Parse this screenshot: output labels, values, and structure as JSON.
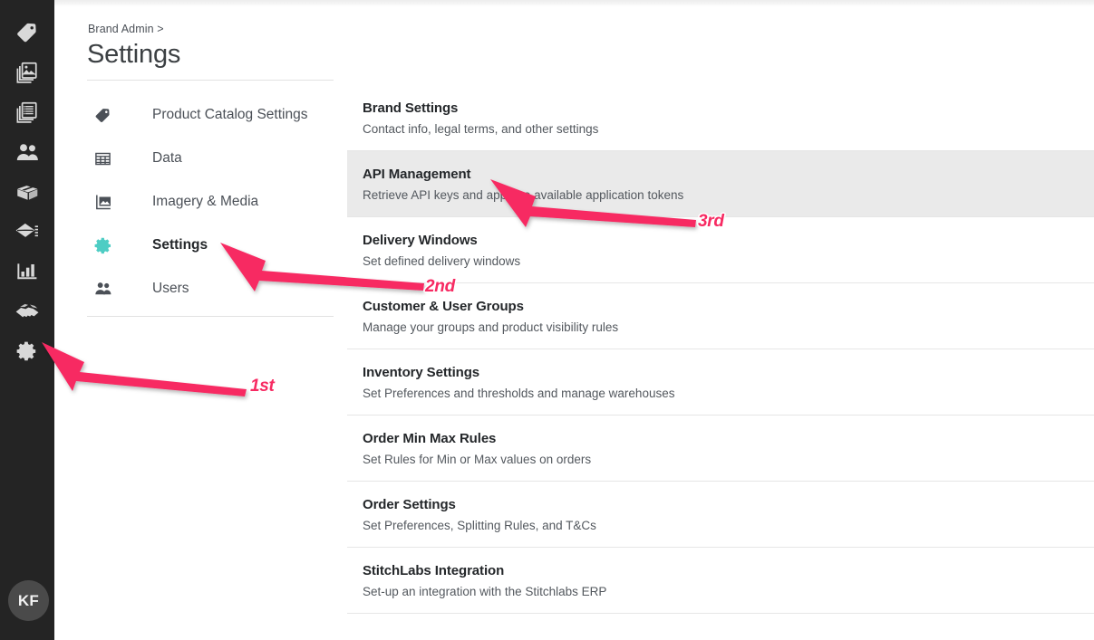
{
  "colors": {
    "rail_bg": "#242424",
    "accent_teal": "#4ecdc4",
    "annotation_pink": "#f72a62",
    "highlight_row": "#eaeaea"
  },
  "rail": {
    "items": [
      {
        "icon": "tag-icon",
        "name": "rail-item-catalog"
      },
      {
        "icon": "images-icon",
        "name": "rail-item-media"
      },
      {
        "icon": "list-document-icon",
        "name": "rail-item-content"
      },
      {
        "icon": "users-icon",
        "name": "rail-item-customers"
      },
      {
        "icon": "box-icon",
        "name": "rail-item-products"
      },
      {
        "icon": "envelope-list-icon",
        "name": "rail-item-orders"
      },
      {
        "icon": "bar-chart-icon",
        "name": "rail-item-reports"
      },
      {
        "icon": "handshake-icon",
        "name": "rail-item-partners"
      },
      {
        "icon": "gear-icon",
        "name": "rail-item-settings"
      }
    ],
    "avatar_initials": "KF"
  },
  "header": {
    "breadcrumb": "Brand Admin >",
    "title": "Settings"
  },
  "subnav": {
    "items": [
      {
        "label": "Product Catalog Settings",
        "icon": "tag-icon",
        "active": false
      },
      {
        "label": "Data",
        "icon": "table-grid-icon",
        "active": false
      },
      {
        "label": "Imagery & Media",
        "icon": "image-icon",
        "active": false
      },
      {
        "label": "Settings",
        "icon": "gear-icon",
        "active": true
      },
      {
        "label": "Users",
        "icon": "users-icon",
        "active": false
      }
    ]
  },
  "settings_list": {
    "rows": [
      {
        "title": "Brand Settings",
        "desc": "Contact info, legal terms, and other settings",
        "highlighted": false
      },
      {
        "title": "API Management",
        "desc": "Retrieve API keys and approve available application tokens",
        "highlighted": true
      },
      {
        "title": "Delivery Windows",
        "desc": "Set defined delivery windows",
        "highlighted": false
      },
      {
        "title": "Customer & User Groups",
        "desc": "Manage your groups and product visibility rules",
        "highlighted": false
      },
      {
        "title": "Inventory Settings",
        "desc": "Set Preferences and thresholds and manage warehouses",
        "highlighted": false
      },
      {
        "title": "Order Min Max Rules",
        "desc": "Set Rules for Min or Max values on orders",
        "highlighted": false
      },
      {
        "title": "Order Settings",
        "desc": "Set Preferences, Splitting Rules, and T&Cs",
        "highlighted": false
      },
      {
        "title": "StitchLabs Integration",
        "desc": "Set-up an integration with the Stitchlabs ERP",
        "highlighted": false
      }
    ]
  },
  "annotations": {
    "steps": [
      {
        "label": "1st",
        "target": "rail-item-settings"
      },
      {
        "label": "2nd",
        "target": "subnav-item-settings"
      },
      {
        "label": "3rd",
        "target": "setting-row-api-management"
      }
    ]
  }
}
